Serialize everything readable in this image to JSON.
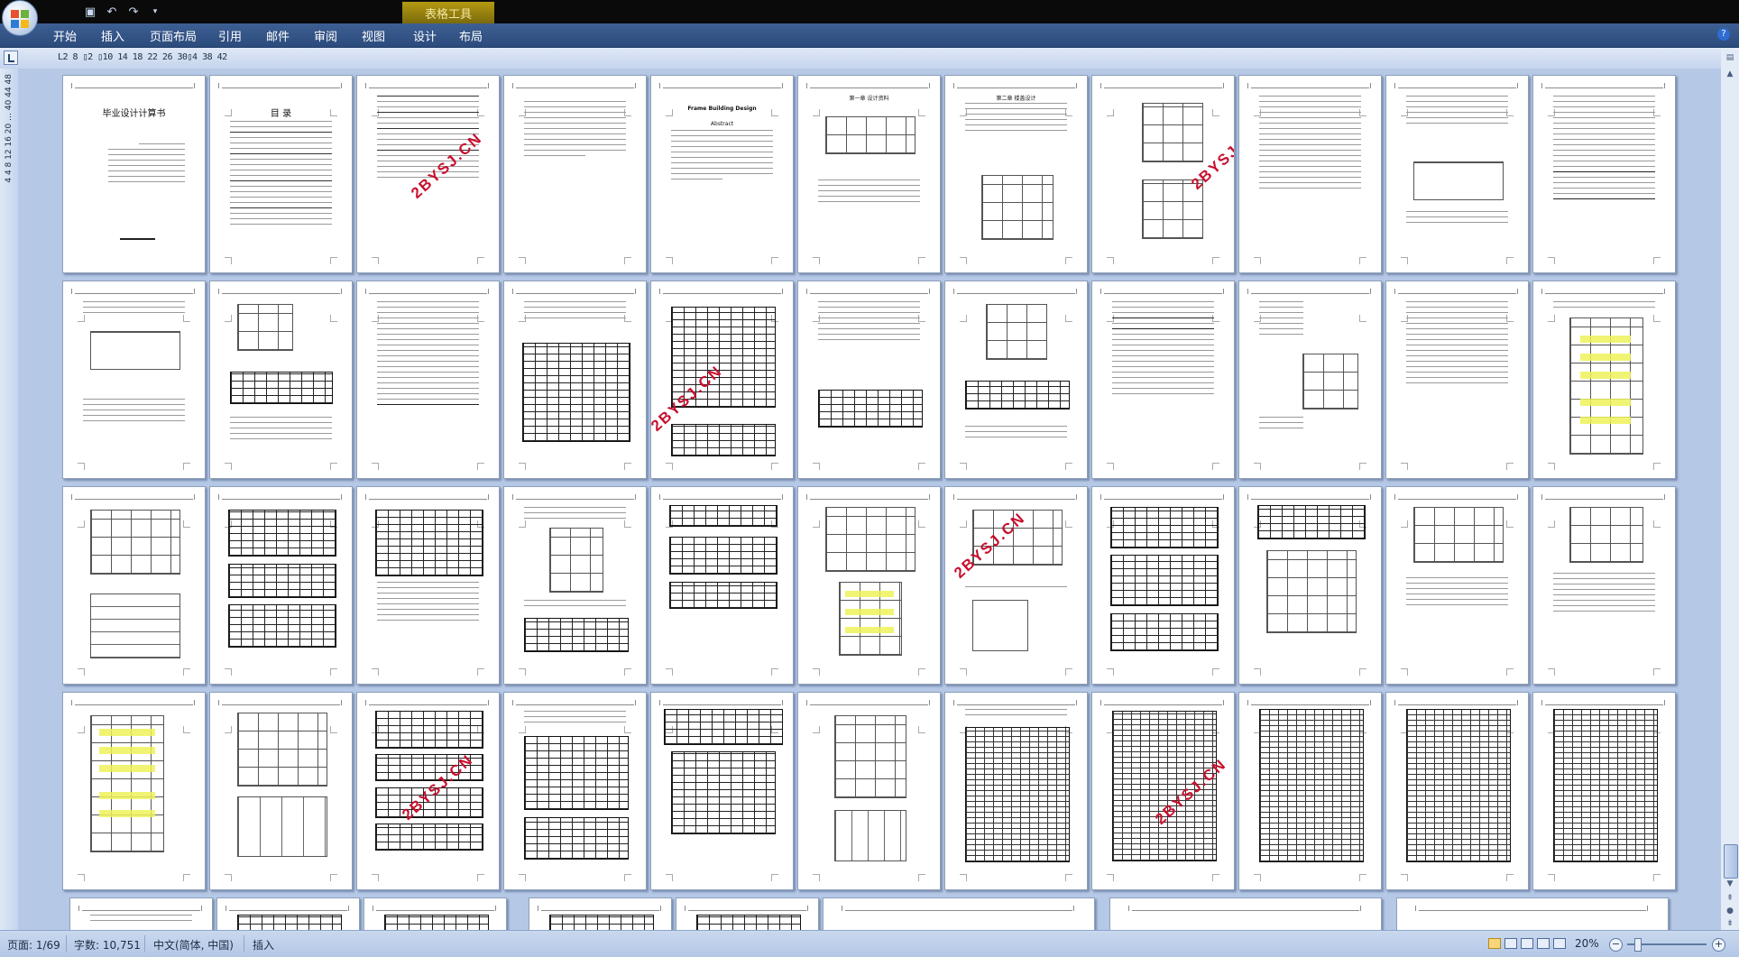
{
  "titlebar": {
    "context_tab": "表格工具",
    "quick_access": [
      "save-icon",
      "undo-icon",
      "redo-icon",
      "customize-icon"
    ]
  },
  "ribbon": {
    "tabs": [
      "开始",
      "插入",
      "页面布局",
      "引用",
      "邮件",
      "审阅",
      "视图",
      "设计",
      "布局"
    ]
  },
  "ruler": {
    "horizontal_marks": "L2 8 ▯2 ▯10 14 18 22 26 30▯4 38 42",
    "vertical_marks": "4 4 8 12 16 20 … 40 44 48"
  },
  "document": {
    "pages": {
      "cover_title": "毕业设计计算书",
      "toc_title": "目  录",
      "abstract_title": "Abstract",
      "english_title": "Frame Building Design",
      "chapter1": "第一章 设计资料",
      "chapter2": "第二章 楼盖设计"
    },
    "watermark": "2BYSJ.CN"
  },
  "status": {
    "page": "页面: 1/69",
    "words": "字数: 10,751",
    "language": "中文(简体, 中国)",
    "mode": "插入",
    "zoom": "20%"
  },
  "colors": {
    "titlebar": "#0a0a0a",
    "ribbon": "#2b4b7c",
    "workspace": "#b5c8e6",
    "watermark": "#c8102e",
    "highlight": "#eef25a"
  }
}
